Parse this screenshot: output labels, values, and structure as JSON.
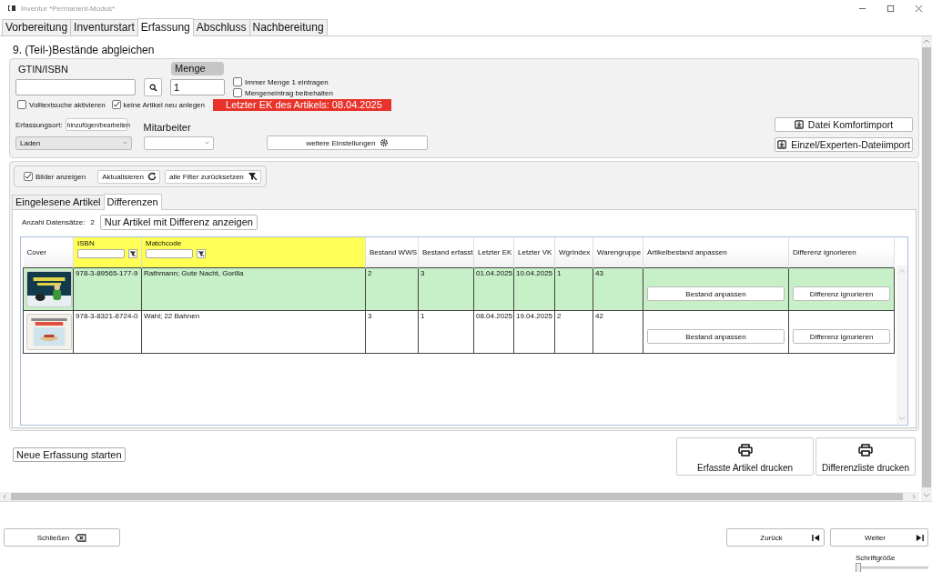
{
  "window": {
    "title": "Inventur *Permanent-Modus*"
  },
  "tabs": [
    {
      "label": "Vorbereitung",
      "selected": false
    },
    {
      "label": "Inventurstart",
      "selected": false
    },
    {
      "label": "Erfassung",
      "selected": true
    },
    {
      "label": "Abschluss",
      "selected": false
    },
    {
      "label": "Nachbereitung",
      "selected": false
    }
  ],
  "section_title": "9. (Teil-)Bestände abgleichen",
  "capture": {
    "gtin_label": "GTIN/ISBN",
    "quantity_label": "Menge",
    "quantity_value": "1",
    "options": [
      {
        "label": "Immer Menge 1 eintragen",
        "checked": false
      },
      {
        "label": "Mengeneintrag beibehalten",
        "checked": false
      }
    ],
    "flags": [
      {
        "label": "Volltextsuche aktivieren",
        "checked": false
      },
      {
        "label": "keine Artikel neu anlegen",
        "checked": true
      }
    ],
    "banner": "Letzter EK des Artikels: 08.04.2025",
    "location_label": "Erfassungsort:",
    "location_edit": "hinzufügen/bearbeiten",
    "location_value": "Laden",
    "employee_label": "Mitarbeiter",
    "more_settings": "weitere Einstellungen",
    "import_buttons": [
      "Datei Komfortimport",
      "Einzel/Experten-Dateiimport"
    ]
  },
  "toolbar": {
    "show_images": {
      "label": "Bilder anzeigen",
      "checked": true
    },
    "refresh": "Aktualisieren",
    "reset_filters": "alle Filter zurücksetzen"
  },
  "subtabs": [
    {
      "label": "Eingelesene Artikel",
      "selected": false
    },
    {
      "label": "Differenzen",
      "selected": true
    }
  ],
  "record_count_label": "Anzahl Datensätze:",
  "record_count": "2",
  "diff_only_button": "Nur Artikel mit Differenz anzeigen",
  "table": {
    "columns": [
      {
        "label": "Cover",
        "filterable": false
      },
      {
        "label": "ISBN",
        "filterable": true
      },
      {
        "label": "Matchcode",
        "filterable": true
      },
      {
        "label": "Bestand WWS",
        "filterable": false
      },
      {
        "label": "Bestand erfasst",
        "filterable": false
      },
      {
        "label": "Letzter EK",
        "filterable": false
      },
      {
        "label": "Letzter VK",
        "filterable": false
      },
      {
        "label": "WgrIndex",
        "filterable": false
      },
      {
        "label": "Warengruppe",
        "filterable": false
      },
      {
        "label": "Artikelbestand anpassen",
        "filterable": false
      },
      {
        "label": "Differenz ignorieren",
        "filterable": false
      }
    ],
    "rows": [
      {
        "selected": true,
        "isbn": "978-3-89565-177-9",
        "matchcode": "Rathmann; Gute Nacht, Gorilla",
        "stock_wws": "2",
        "stock_counted": "3",
        "last_ek": "01.04.2025",
        "last_vk": "10.04.2025",
        "wgr_index": "1",
        "product_group": "43",
        "adjust_button": "Bestand anpassen",
        "ignore_button": "Differenz ignorieren"
      },
      {
        "selected": false,
        "isbn": "978-3-8321-6724-0",
        "matchcode": "Wahl; 22 Bahnen",
        "stock_wws": "3",
        "stock_counted": "1",
        "last_ek": "08.04.2025",
        "last_vk": "19.04.2025",
        "wgr_index": "2",
        "product_group": "42",
        "adjust_button": "Bestand anpassen",
        "ignore_button": "Differenz ignorieren"
      }
    ]
  },
  "new_capture_button": "Neue Erfassung starten",
  "print_buttons": [
    "Erfasste Artikel drucken",
    "Differenzliste drucken"
  ],
  "footer": {
    "close": "Schließen",
    "back": "Zurück",
    "next": "Weiter",
    "font_size_label": "Schriftgröße",
    "font_size": {
      "level": 0
    }
  }
}
